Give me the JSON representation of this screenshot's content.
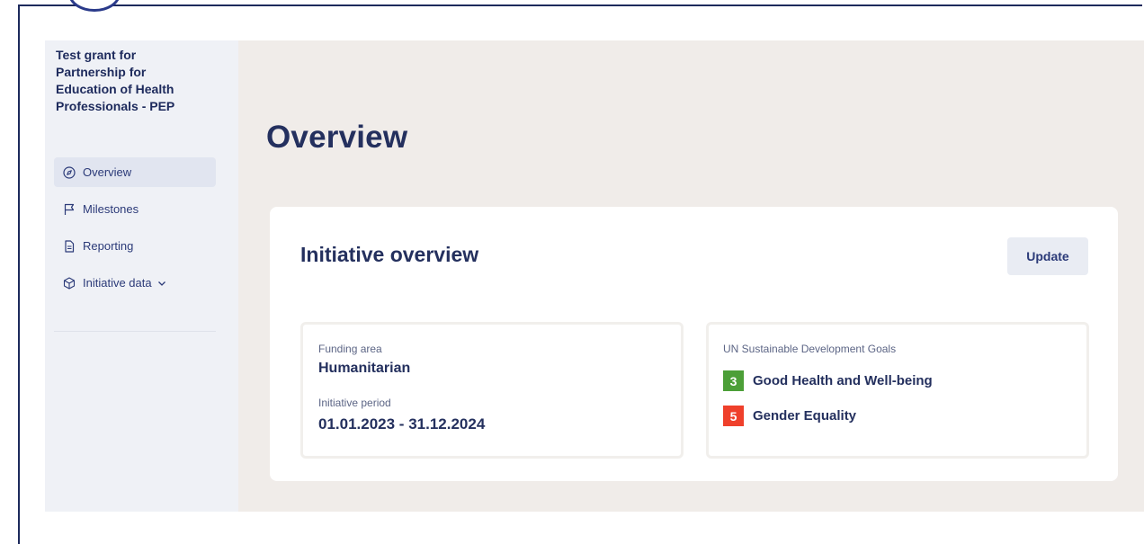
{
  "sidebar": {
    "grant_title": "Test grant for Partnership for Education of Health Professionals - PEP",
    "items": [
      {
        "label": "Overview",
        "icon": "compass-icon",
        "active": true
      },
      {
        "label": "Milestones",
        "icon": "flag-icon"
      },
      {
        "label": "Reporting",
        "icon": "document-icon"
      },
      {
        "label": "Initiative data",
        "icon": "cube-icon",
        "has_dropdown": true
      }
    ]
  },
  "main": {
    "title": "Overview",
    "card": {
      "title": "Initiative overview",
      "update_label": "Update",
      "funding_area_label": "Funding area",
      "funding_area_value": "Humanitarian",
      "period_label": "Initiative period",
      "period_value": "01.01.2023 - 31.12.2024",
      "sdg_label": "UN Sustainable Development Goals",
      "sdgs": [
        {
          "number": "3",
          "name": "Good Health and Well-being",
          "color": "#4c9f38"
        },
        {
          "number": "5",
          "name": "Gender Equality",
          "color": "#ef402b"
        }
      ]
    }
  },
  "colors": {
    "primary_text": "#24305e",
    "sidebar_bg": "#eff1f6",
    "main_bg": "#f0ece9"
  }
}
